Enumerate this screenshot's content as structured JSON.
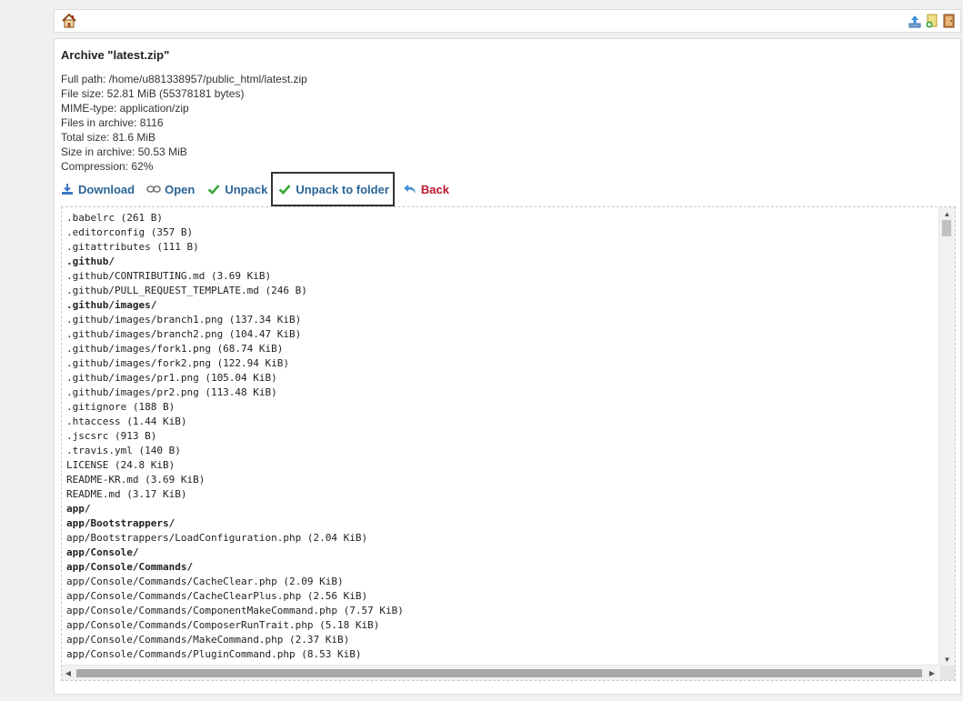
{
  "toolbar": {
    "home_icon": "home-icon",
    "right_icons": [
      "upload-icon",
      "new-file-icon",
      "exit-icon"
    ]
  },
  "archive": {
    "title": "Archive \"latest.zip\"",
    "info": [
      "Full path: /home/u881338957/public_html/latest.zip",
      "File size: 52.81 MiB (55378181 bytes)",
      "MIME-type: application/zip",
      "Files in archive: 8116",
      "Total size: 81.6 MiB",
      "Size in archive: 50.53 MiB",
      "Compression: 62%"
    ]
  },
  "actions": {
    "download": "Download",
    "open": "Open",
    "unpack": "Unpack",
    "unpack_to_folder": "Unpack to folder",
    "back": "Back"
  },
  "files": [
    {
      "text": ".babelrc (261 B)",
      "dir": false
    },
    {
      "text": ".editorconfig (357 B)",
      "dir": false
    },
    {
      "text": ".gitattributes (111 B)",
      "dir": false
    },
    {
      "text": ".github/",
      "dir": true
    },
    {
      "text": ".github/CONTRIBUTING.md (3.69 KiB)",
      "dir": false
    },
    {
      "text": ".github/PULL_REQUEST_TEMPLATE.md (246 B)",
      "dir": false
    },
    {
      "text": ".github/images/",
      "dir": true
    },
    {
      "text": ".github/images/branch1.png (137.34 KiB)",
      "dir": false
    },
    {
      "text": ".github/images/branch2.png (104.47 KiB)",
      "dir": false
    },
    {
      "text": ".github/images/fork1.png (68.74 KiB)",
      "dir": false
    },
    {
      "text": ".github/images/fork2.png (122.94 KiB)",
      "dir": false
    },
    {
      "text": ".github/images/pr1.png (105.04 KiB)",
      "dir": false
    },
    {
      "text": ".github/images/pr2.png (113.48 KiB)",
      "dir": false
    },
    {
      "text": ".gitignore (188 B)",
      "dir": false
    },
    {
      "text": ".htaccess (1.44 KiB)",
      "dir": false
    },
    {
      "text": ".jscsrc (913 B)",
      "dir": false
    },
    {
      "text": ".travis.yml (140 B)",
      "dir": false
    },
    {
      "text": "LICENSE (24.8 KiB)",
      "dir": false
    },
    {
      "text": "README-KR.md (3.69 KiB)",
      "dir": false
    },
    {
      "text": "README.md (3.17 KiB)",
      "dir": false
    },
    {
      "text": "app/",
      "dir": true
    },
    {
      "text": "app/Bootstrappers/",
      "dir": true
    },
    {
      "text": "app/Bootstrappers/LoadConfiguration.php (2.04 KiB)",
      "dir": false
    },
    {
      "text": "app/Console/",
      "dir": true
    },
    {
      "text": "app/Console/Commands/",
      "dir": true
    },
    {
      "text": "app/Console/Commands/CacheClear.php (2.09 KiB)",
      "dir": false
    },
    {
      "text": "app/Console/Commands/CacheClearPlus.php (2.56 KiB)",
      "dir": false
    },
    {
      "text": "app/Console/Commands/ComponentMakeCommand.php (7.57 KiB)",
      "dir": false
    },
    {
      "text": "app/Console/Commands/ComposerRunTrait.php (5.18 KiB)",
      "dir": false
    },
    {
      "text": "app/Console/Commands/MakeCommand.php (2.37 KiB)",
      "dir": false
    },
    {
      "text": "app/Console/Commands/PluginCommand.php (8.53 KiB)",
      "dir": false
    }
  ]
}
